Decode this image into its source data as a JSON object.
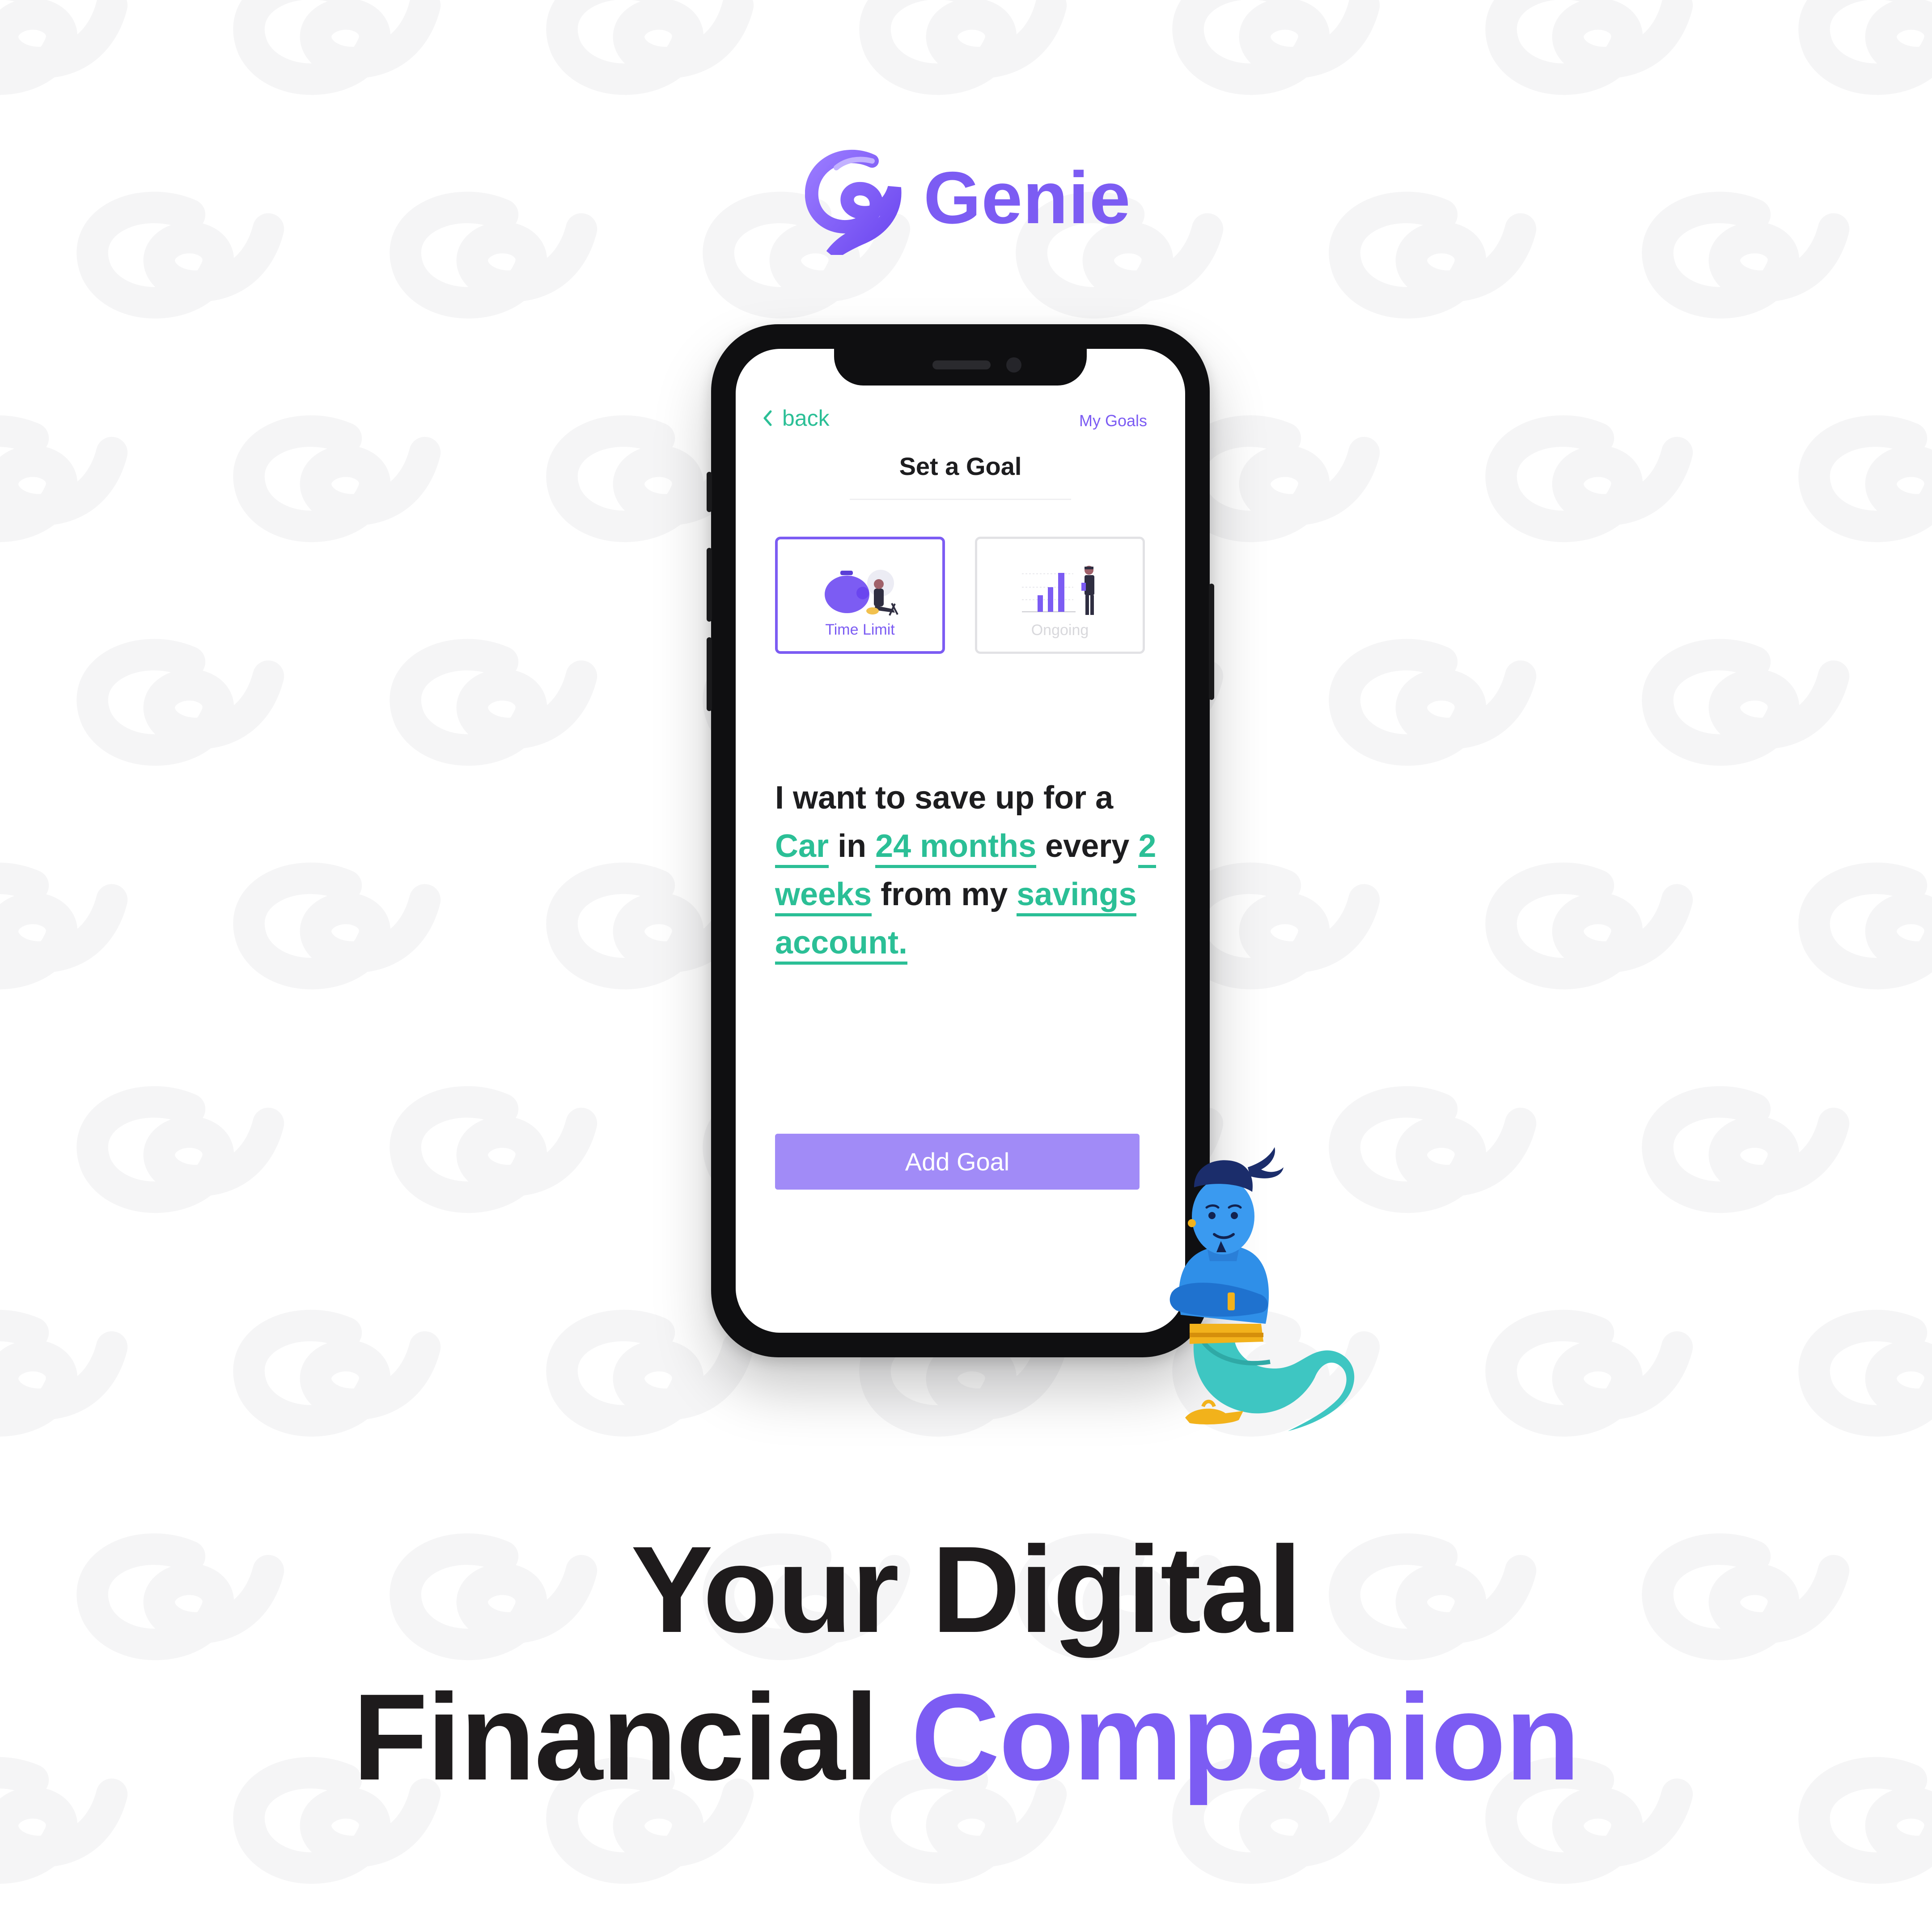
{
  "brand": {
    "name": "Genie",
    "logo_icon": "genie-swirl-icon"
  },
  "phone": {
    "nav": {
      "back_label": "back",
      "my_goals_label": "My Goals"
    },
    "title": "Set a Goal",
    "goal_types": [
      {
        "label": "Time Limit",
        "selected": true,
        "icon": "piggy-bank-illustration"
      },
      {
        "label": "Ongoing",
        "selected": false,
        "icon": "bar-chart-illustration"
      }
    ],
    "goal_sentence": {
      "p1": "I want to save up for a ",
      "item": "Car",
      "p2": " in ",
      "duration": "24 months",
      "p3": " every ",
      "frequency": "2 weeks",
      "p4": " from my ",
      "account": "savings account."
    },
    "add_goal_label": "Add Goal"
  },
  "headline": {
    "line1": "Your Digital",
    "line2_a": "Financial ",
    "line2_b": "Companion"
  },
  "colors": {
    "brand_purple": "#7c5cf3",
    "button_purple": "#a18bf7",
    "accent_green": "#2bbf96",
    "text_dark": "#1e1b1c"
  }
}
